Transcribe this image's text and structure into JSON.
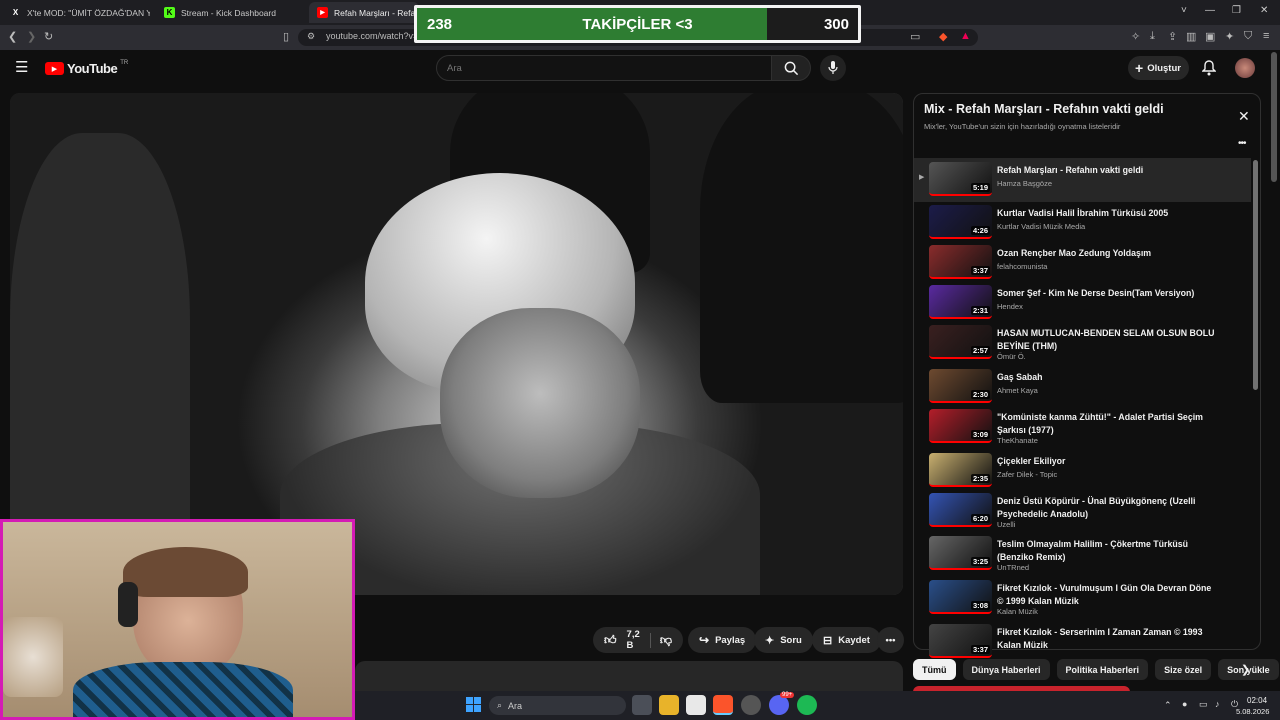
{
  "browser": {
    "tabs": [
      {
        "label": "X'te MOD: \"ÜMİT ÖZDAĞ'DAN YENİ",
        "icon": "x-logo-icon"
      },
      {
        "label": "Stream - Kick Dashboard",
        "icon": "kick-logo-icon"
      },
      {
        "label": "Refah Marşları - Refahın V",
        "icon": "youtube-logo-icon"
      }
    ],
    "url": "youtube.com/watch?v=",
    "window_controls": [
      "˅",
      "—",
      "❐",
      "✕"
    ]
  },
  "goal_overlay": {
    "current": "238",
    "label": "TAKİPÇİLER <3",
    "target": "300",
    "progress": 0.793
  },
  "youtube": {
    "logo": "YouTube",
    "region": "TR",
    "search_placeholder": "Ara",
    "create_label": "Oluştur"
  },
  "actions": {
    "like_count": "7,2 B",
    "share": "Paylaş",
    "ask": "Soru",
    "save": "Kaydet"
  },
  "playlist": {
    "title": "Mix - Refah Marşları - Refahın vakti geldi",
    "subtitle": "Mix'ler, YouTube'un sizin için hazırladığı oynatma listeleridir",
    "items": [
      {
        "title": "Refah Marşları - Refahın vakti geldi",
        "author": "Hamza Başgöze",
        "duration": "5:19"
      },
      {
        "title": "Kurtlar Vadisi Halil İbrahim Türküsü 2005",
        "author": "Kurtlar Vadisi Müzik Media",
        "duration": "4:26"
      },
      {
        "title": "Ozan Rençber Mao Zedung Yoldaşım",
        "author": "felahcomunista",
        "duration": "3:37"
      },
      {
        "title": "Somer Şef - Kim Ne Derse Desin(Tam Versiyon)",
        "author": "Hendex",
        "duration": "2:31"
      },
      {
        "title": "HASAN MUTLUCAN-BENDEN SELAM OLSUN BOLU BEYİNE (THM)",
        "author": "Ömür Ö.",
        "duration": "2:57"
      },
      {
        "title": "Gaş Sabah",
        "author": "Ahmet Kaya",
        "duration": "2:30"
      },
      {
        "title": "\"Komüniste kanma Zühtü!\" - Adalet Partisi Seçim Şarkısı (1977)",
        "author": "TheKhanate",
        "duration": "3:09"
      },
      {
        "title": "Çiçekler Ekiliyor",
        "author": "Zafer Dilek - Topic",
        "duration": "2:35"
      },
      {
        "title": "Deniz Üstü Köpürür - Ünal Büyükgönenç (Uzelli Psychedelic Anadolu)",
        "author": "Uzelli",
        "duration": "6:20"
      },
      {
        "title": "Teslim Olmayalım Halilim - Çökertme Türküsü (Benziko Remix)",
        "author": "UnTRned",
        "duration": "3:25"
      },
      {
        "title": "Fikret Kızılok - Vurulmuşum I Gün Ola Devran Döne © 1999 Kalan Müzik",
        "author": "Kalan Müzik",
        "duration": "3:08"
      },
      {
        "title": "Fikret Kızılok - Serserinim I Zaman Zaman © 1993 Kalan Müzik",
        "author": "",
        "duration": "3:37"
      }
    ]
  },
  "chips": [
    "Tümü",
    "Dünya Haberleri",
    "Politika Haberleri",
    "Size özel",
    "Son yükle"
  ],
  "taskbar": {
    "search": "Ara",
    "time": "02:04",
    "date": "5.08.2026",
    "badge": "99+"
  },
  "colors": {
    "accent_red": "#ff0000",
    "goal_green": "#2e7d32",
    "webcam_border": "#d41bb5"
  }
}
